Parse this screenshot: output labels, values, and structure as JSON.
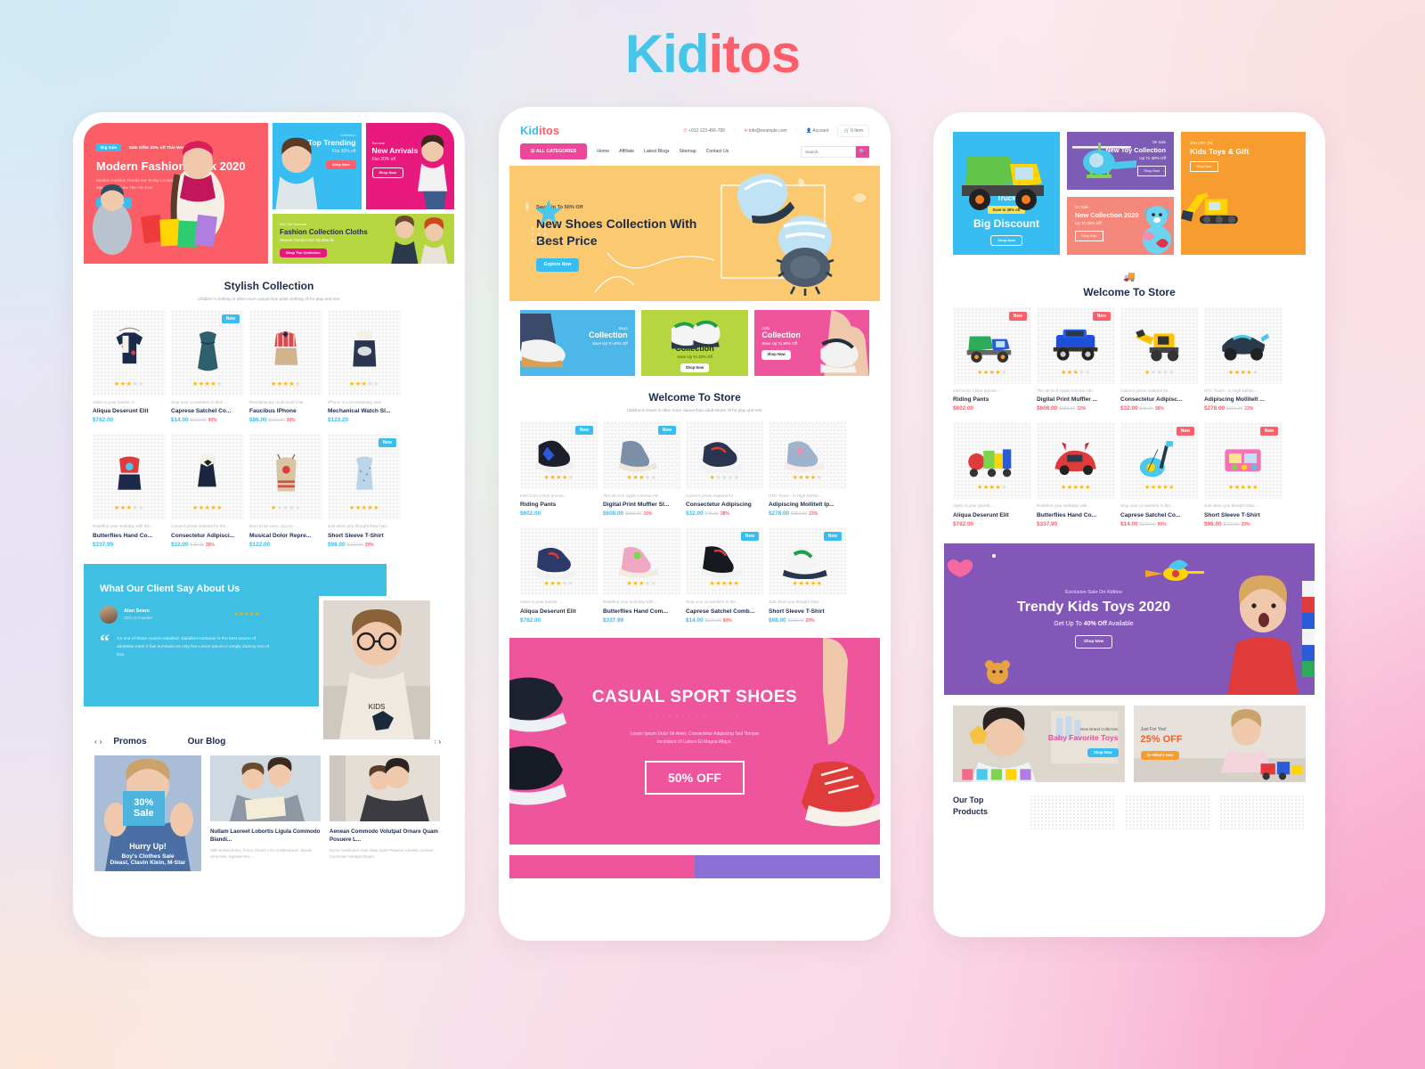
{
  "brand": {
    "part1": "Kid",
    "part2": "itos",
    "color1": "#45c5e8",
    "color2": "#fc5e6a"
  },
  "phone1": {
    "hero": {
      "tag": "Big Sale",
      "kicker": "Sale Offer 20% off This Week",
      "title": "Modern Fashion Look 2020",
      "desc_line1": "Modern Fashion Trends Are To My Constantly In Our Store",
      "desc_line2": "Many Promotions The For Ever",
      "cta": "Read More"
    },
    "mini": [
      {
        "label": "Collection",
        "title": "Top Trending",
        "sub": "Flat 30% off",
        "cta": "Shop Now",
        "color": "#38bdf2"
      },
      {
        "label": "Summer",
        "title": "New Arrivals",
        "sub": "Flat 30% off",
        "cta": "Shop Now",
        "color": "#e8197d"
      },
      {
        "label": "Hot The Summer",
        "title": "Fashion Collection Cloths",
        "sub": "Newest Trends From Top Brands",
        "cta": "Shop The Collection",
        "color": "#b6d63f"
      }
    ],
    "section": {
      "title": "Stylish Collection",
      "subtitle": "Children`s clothing is often more casual than adult clothing, fit for play and rest."
    },
    "products_row1": [
      {
        "desc": "Video in your pocket. It...",
        "name": "Aliqua Deserunt Elit",
        "price": "$782.00",
        "old": "",
        "pct": "",
        "stars": 3,
        "badge": ""
      },
      {
        "desc": "Stop your co-workers in their ...",
        "name": "Caprese Satchel Co...",
        "price": "$14.00",
        "old": "$122.00",
        "pct": "90%",
        "stars": 4,
        "badge": "New"
      },
      {
        "desc": "Revolutionary multi-touch inte...",
        "name": "Faucibus IPhone",
        "price": "$86.00",
        "old": "$122.00",
        "pct": "30%",
        "stars": 4,
        "badge": ""
      },
      {
        "desc": "iPhone is a revolutionary new ...",
        "name": "Mechanical Watch Sl...",
        "price": "$123.20",
        "old": "",
        "pct": "",
        "stars": 3,
        "badge": ""
      }
    ],
    "products_row2": [
      {
        "desc": "Redefine your workday with the...",
        "name": "Butterflies Hand Co...",
        "price": "$337.99",
        "old": "",
        "pct": "",
        "stars": 3,
        "badge": ""
      },
      {
        "desc": "Canon's press material for the...",
        "name": "Consectetur Adipisci...",
        "price": "$32.00",
        "old": "$45.00",
        "pct": "38%",
        "stars": 5,
        "badge": ""
      },
      {
        "desc": "Born to be worn, clip on...",
        "name": "Musical Dolor Repre...",
        "price": "$122.00",
        "old": "",
        "pct": "",
        "stars": 1,
        "badge": ""
      },
      {
        "desc": "Just when you thought iMac had ...",
        "name": "Short Sleeve T-Shirt",
        "price": "$98.00",
        "old": "$122.00",
        "pct": "20%",
        "stars": 5,
        "badge": "New"
      }
    ],
    "testimonial": {
      "heading": "What Our Client Say About Us",
      "author": "Alan Sears",
      "role": "CEO At Founder",
      "stars": 5,
      "quote_mark": "“",
      "quote": "I'm one of those custom satisfied, Satisfied customer is the best source of advertise ment It has survived not only five Lorem Ipsum is simply dummy text of tled."
    },
    "blog": {
      "promos_label": "Promos",
      "blog_label": "Our Blog",
      "arrow_prev": "‹",
      "arrow_next": "›",
      "promo_card": {
        "pct": "30%",
        "sale": "Sale",
        "hurry": "Hurry Up!",
        "line1": "Boy's Clothes Sale",
        "line2": "Dieasl, Clavin Klein, M-Star"
      },
      "posts": [
        {
          "title": "Nullam Laoreet Lobortis Ligula Commodo Blandi...",
          "excerpt": "Nibh Euismod Nec, Fusce Ornare A Ex At Elementum. Mauris Urna Ante, Egestas Nec ..."
        },
        {
          "title": "Aenean Commodo Volutpat Ornare Quam Posuere L...",
          "excerpt": "Donec Vestibulum Sem Vitae Quam Posuere Lobortis. Aenean Commodo Volutpat Ornare..."
        }
      ]
    }
  },
  "phone2": {
    "header": {
      "logo1": "Kid",
      "logo2": "itos",
      "phone": "+012 123-456-789",
      "email": "info@example.com",
      "account": "Account",
      "cart": "0 Item",
      "phone_icon": "phone-icon",
      "mail_icon": "mail-icon",
      "user_icon": "user-icon",
      "cart_icon": "cart-icon"
    },
    "nav": {
      "categories": "ALL CATEGORIES",
      "links": [
        "Home",
        "Affiliate",
        "Latest Blogs",
        "Sitemap",
        "Contact Us"
      ],
      "search_placeholder": "Search",
      "search_icon": "search-icon"
    },
    "hero": {
      "kicker": "Save Up To 50% Off",
      "title_l1": "New Shoes Collection With",
      "title_l2": "Best Price",
      "cta": "Explore Now"
    },
    "collections": [
      {
        "label": "Boys",
        "title": "Collection",
        "sub": "Save Up To 30% Off",
        "cta": "Shop Now",
        "color": "#4cb7e8",
        "align": "right"
      },
      {
        "label": "Boys",
        "title": "Collection",
        "sub": "Save Up To 30% Off",
        "cta": "Shop Now",
        "color": "#b6d63f",
        "align": "center"
      },
      {
        "label": "Girls",
        "title": "Collection",
        "sub": "Save Up To 30% Off",
        "cta": "Shop Now",
        "color": "#ef559d",
        "align": "left"
      }
    ],
    "section": {
      "title": "Welcome To Store",
      "subtitle": "Children's shoes is often more casual than adult shoes, fit for play and rest."
    },
    "products_row1": [
      {
        "desc": "Intel Core 2 Duo proces...",
        "name": "Riding Pants",
        "price": "$602.00",
        "old": "",
        "pct": "",
        "stars": 4,
        "badge": "New"
      },
      {
        "desc": "The 30-inch Apple Cinema HD...",
        "name": "Digital Print Muffler Sl...",
        "price": "$608.00",
        "old": "$683.00",
        "pct": "33%",
        "stars": 3,
        "badge": "New"
      },
      {
        "desc": "Canon's press material for ...",
        "name": "Consectetur Adipiscing",
        "price": "$32.00",
        "old": "$45.00",
        "pct": "38%",
        "stars": 1,
        "badge": ""
      },
      {
        "desc": "HTC Touch - in High Definit...",
        "name": "Adipiscing Mollitelt Ip...",
        "price": "$278.00",
        "old": "$262.00",
        "pct": "23%",
        "stars": 4,
        "badge": ""
      }
    ],
    "products_row2": [
      {
        "desc": "Video in your pocket. ...",
        "name": "Aliqua Deserunt Elit",
        "price": "$782.00",
        "old": "",
        "pct": "",
        "stars": 3,
        "badge": ""
      },
      {
        "desc": "Redefine your workday with ...",
        "name": "Butterflies Hand Com...",
        "price": "$337.99",
        "old": "",
        "pct": "",
        "stars": 3,
        "badge": ""
      },
      {
        "desc": "Stop your co-workers in the...",
        "name": "Caprese Satchel Comb...",
        "price": "$14.00",
        "old": "$122.00",
        "pct": "90%",
        "stars": 5,
        "badge": "New"
      },
      {
        "desc": "Just when you thought iMac ...",
        "name": "Short Sleeve T-Shirt",
        "price": "$98.00",
        "old": "$122.00",
        "pct": "20%",
        "stars": 5,
        "badge": "New"
      }
    ],
    "sport_banner": {
      "title": "CASUAL SPORT SHOES",
      "desc_l1": "Lorem Ipsum Dolor Sit Amet, Consectetur Adipiscing Sed Tempor",
      "desc_l2": "Incididunt Ut Labore Et Magna Aliqua.",
      "offer": "50% OFF"
    }
  },
  "phone3": {
    "banners": {
      "truck": {
        "label": "Truck",
        "pill": "Save to 30% off",
        "title": "Big Discount",
        "cta": "Shop Now",
        "color": "#38bdf2"
      },
      "toy": {
        "label": "On Sale",
        "title": "New Toy Collection",
        "sub": "Up To 30% Off",
        "cta": "Shop Now",
        "color": "#7c5cb4"
      },
      "bear": {
        "label": "On Sale",
        "title": "New Collection 2020",
        "sub": "Up To 30% Off",
        "cta": "Shop Now",
        "color": "#f4887a"
      },
      "gift": {
        "label": "30% OFF ON",
        "title": "Kids Toys & Gift",
        "cta": "Shop Now",
        "color": "#f79c2e"
      }
    },
    "section": {
      "title": "Welcome To Store",
      "icon": "truck-icon"
    },
    "products_row1": [
      {
        "desc": "Intel Core 2 Duo proces...",
        "name": "Riding Pants",
        "price": "$602.00",
        "old": "",
        "pct": "",
        "stars": 4,
        "badge": "New"
      },
      {
        "desc": "The 30-inch Apple Cinema HD...",
        "name": "Digital Print Muffler ...",
        "price": "$608.00",
        "old": "$683.00",
        "pct": "33%",
        "stars": 3,
        "badge": "New"
      },
      {
        "desc": "Canon's press material for ...",
        "name": "Consectetur Adipisc...",
        "price": "$32.00",
        "old": "$45.00",
        "pct": "38%",
        "stars": 1,
        "badge": ""
      },
      {
        "desc": "HTC Touch - in High Definit...",
        "name": "Adipiscing Mollitelt ...",
        "price": "$278.00",
        "old": "$262.00",
        "pct": "23%",
        "stars": 4,
        "badge": ""
      }
    ],
    "products_row2": [
      {
        "desc": "Video in your pocket. ...",
        "name": "Aliqua Deserunt Elit",
        "price": "$782.00",
        "old": "",
        "pct": "",
        "stars": 4,
        "badge": ""
      },
      {
        "desc": "Redefine your workday with ...",
        "name": "Butterflies Hand Co...",
        "price": "$337.99",
        "old": "",
        "pct": "",
        "stars": 5,
        "badge": ""
      },
      {
        "desc": "Stop your co-workers in the...",
        "name": "Caprese Satchel Co...",
        "price": "$14.00",
        "old": "$122.00",
        "pct": "90%",
        "stars": 5,
        "badge": "New"
      },
      {
        "desc": "Just when you thought iMac ...",
        "name": "Short Sleeve T-Shirt",
        "price": "$98.00",
        "old": "$122.00",
        "pct": "20%",
        "stars": 5,
        "badge": "New"
      }
    ],
    "trendy": {
      "kicker": "Exclusive Sale On Kiditos",
      "title": "Trendy Kids Toys 2020",
      "sub_a": "Get Up To ",
      "sub_b": "40% Off",
      "sub_c": " Available",
      "cta": "Shop Now"
    },
    "promos": [
      {
        "kicker": "New Brand Collection",
        "title": "Baby Favorite Toys",
        "cta": "Shop Now",
        "cta_color": "#38bdf2",
        "title_color": "#ec4899"
      },
      {
        "kicker": "Just For You!",
        "title": "25% OFF",
        "cta": "So What's New",
        "cta_color": "#f79c2e",
        "title_color": "#f4602a"
      }
    ],
    "top_products": {
      "l1": "Our Top",
      "l2": "Products"
    }
  }
}
